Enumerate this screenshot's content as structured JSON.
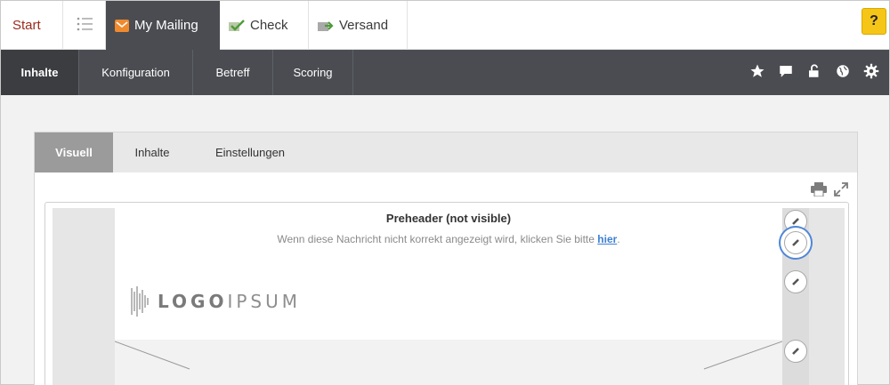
{
  "topbar": {
    "start": "Start",
    "mailing": "My Mailing",
    "check": "Check",
    "versand": "Versand",
    "help": "?"
  },
  "subnav": {
    "items": [
      "Inhalte",
      "Konfiguration",
      "Betreff",
      "Scoring"
    ],
    "active": "Inhalte",
    "icons": [
      "star-icon",
      "comment-icon",
      "unlock-icon",
      "globe-icon",
      "gear-icon"
    ]
  },
  "editor": {
    "tabs": [
      "Visuell",
      "Inhalte",
      "Einstellungen"
    ],
    "active_tab": "Visuell",
    "tools": [
      "print-icon",
      "expand-icon"
    ],
    "preheader": "Preheader (not visible)",
    "notice_text": "Wenn diese Nachricht nicht korrekt angezeigt wird, klicken Sie bitte",
    "notice_link": "hier",
    "notice_end": ".",
    "logo_bold": "LOGO",
    "logo_light": "IPSUM"
  },
  "colors": {
    "nav_dark": "#4a4c51",
    "start_red": "#9b2a1d",
    "help_yellow": "#f5c518",
    "link_blue": "#3b7fd4",
    "highlight_ring": "#4f86d8"
  }
}
